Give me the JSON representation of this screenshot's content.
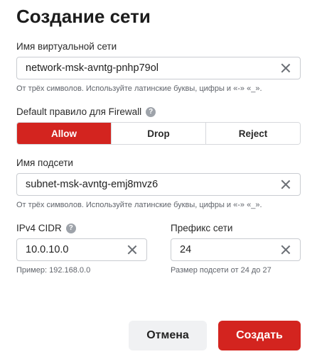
{
  "dialog": {
    "title": "Создание сети"
  },
  "network_name": {
    "label": "Имя виртуальной сети",
    "value": "network-msk-avntg-pnhp79ol",
    "hint": "От трёх символов. Используйте латинские буквы, цифры и «-» «_»."
  },
  "firewall": {
    "label": "Default правило для Firewall",
    "help_icon": "?",
    "options": [
      "Allow",
      "Drop",
      "Reject"
    ],
    "selected": "Allow"
  },
  "subnet_name": {
    "label": "Имя подсети",
    "value": "subnet-msk-avntg-emj8mvz6",
    "hint": "От трёх символов. Используйте латинские буквы, цифры и «-» «_»."
  },
  "cidr": {
    "label": "IPv4 CIDR",
    "help_icon": "?",
    "value": "10.0.10.0",
    "hint": "Пример: 192.168.0.0"
  },
  "prefix": {
    "label": "Префикс сети",
    "value": "24",
    "hint": "Размер подсети от 24 до 27"
  },
  "actions": {
    "cancel_label": "Отмена",
    "create_label": "Создать"
  },
  "colors": {
    "accent": "#d3241f"
  }
}
